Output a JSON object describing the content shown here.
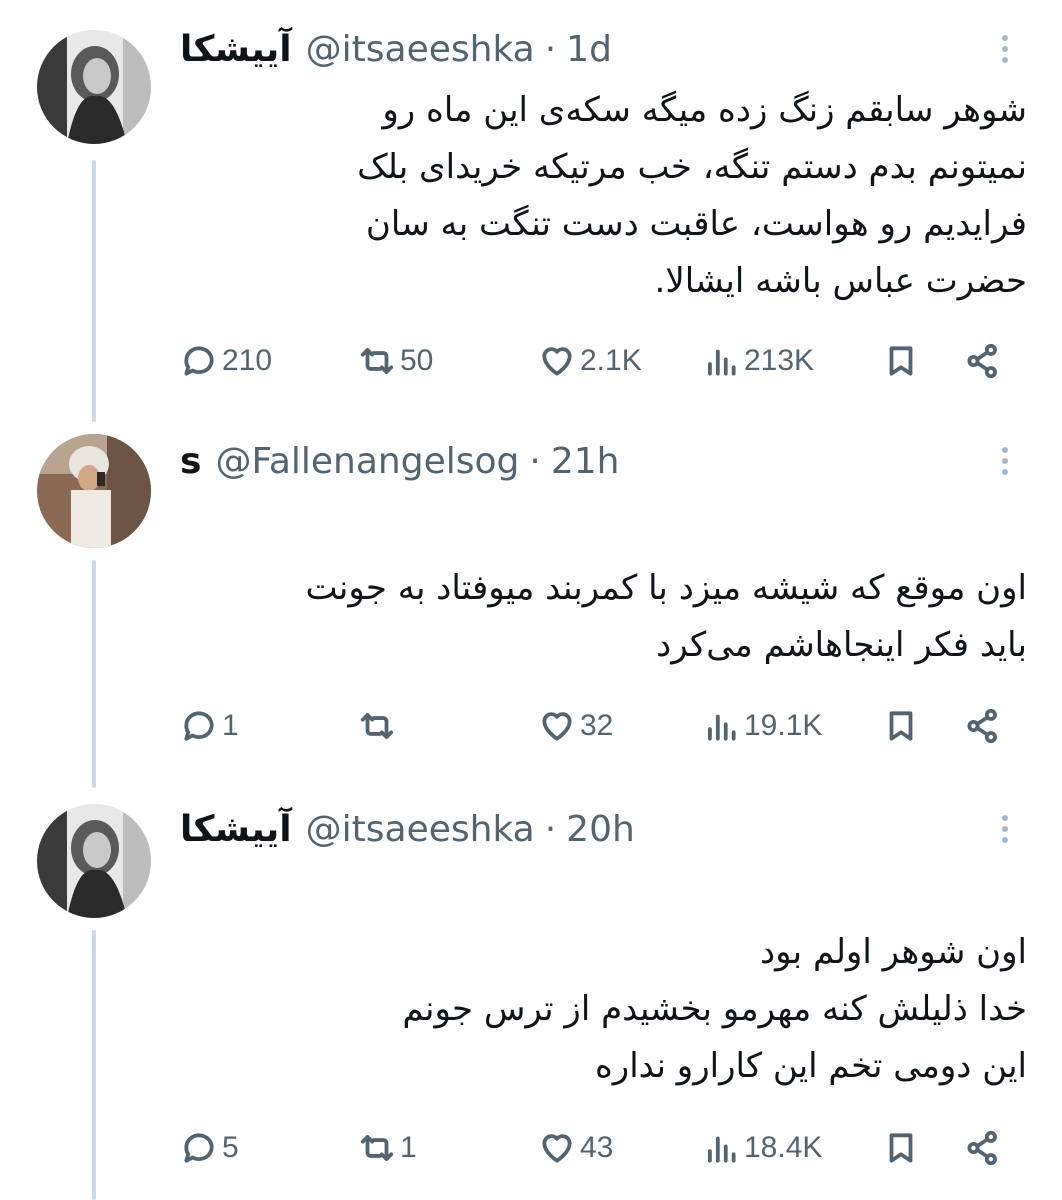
{
  "tweets": [
    {
      "name": "آییشکا",
      "handle": "@itsaeeshka",
      "time": "1d",
      "text": "شوهر سابقم زنگ زده میگه سکه‌ی این ماه رو\nنمیتونم بدم دستم تنگه، خب مرتیکه خریدای بلک\nفرایدیم رو هواست، عاقبت دست تنگت به سان\nحضرت عباس باشه ایشالا.",
      "replies": "210",
      "retweets": "50",
      "likes": "2.1K",
      "views": "213K"
    },
    {
      "name": "s",
      "handle": "@Fallenangelsog",
      "time": "21h",
      "text": "اون موقع که شیشه میزد با کمربند میوفتاد به جونت\nباید فکر اینجاهاشم می‌کرد",
      "replies": "1",
      "retweets": "",
      "likes": "32",
      "views": "19.1K"
    },
    {
      "name": "آییشکا",
      "handle": "@itsaeeshka",
      "time": "20h",
      "text": "اون شوهر اولم بود\nخدا ذلیلش کنه مهرمو بخشیدم از ترس جونم\nاین دومی تخم این کارارو نداره",
      "replies": "5",
      "retweets": "1",
      "likes": "43",
      "views": "18.4K"
    }
  ],
  "separator": "·",
  "colors": {
    "text": "#0f1419",
    "secondary": "#536471",
    "thread_line": "#cfd9de"
  }
}
